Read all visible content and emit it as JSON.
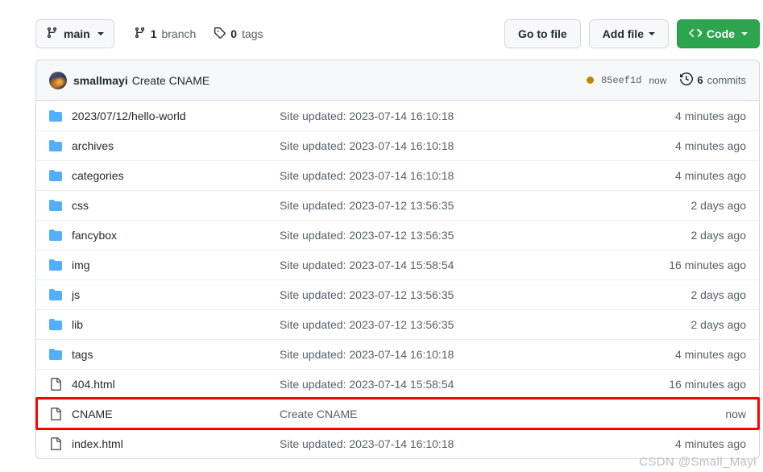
{
  "toolbar": {
    "branch": {
      "label": "main",
      "icon": "branch-icon",
      "caret": "chevron-down-icon"
    },
    "stats": [
      {
        "count": "1",
        "label": "branch",
        "icon": "branch-icon"
      },
      {
        "count": "0",
        "label": "tags",
        "icon": "tag-icon"
      }
    ],
    "go_to_file_label": "Go to file",
    "add_file_label": "Add file",
    "code_label": "Code"
  },
  "commit_bar": {
    "author": "smallmayi",
    "message": "Create CNAME",
    "status_dot_color": "#bf8700",
    "sha": "85eef1d",
    "when": "now",
    "commits_count": "6",
    "commits_label": "commits",
    "history_icon": "history-clock-icon"
  },
  "files": [
    {
      "type": "folder",
      "name": "2023/07/12/hello-world",
      "message": "Site updated: 2023-07-14 16:10:18",
      "time": "4 minutes ago",
      "highlighted": false
    },
    {
      "type": "folder",
      "name": "archives",
      "message": "Site updated: 2023-07-14 16:10:18",
      "time": "4 minutes ago",
      "highlighted": false
    },
    {
      "type": "folder",
      "name": "categories",
      "message": "Site updated: 2023-07-14 16:10:18",
      "time": "4 minutes ago",
      "highlighted": false
    },
    {
      "type": "folder",
      "name": "css",
      "message": "Site updated: 2023-07-12 13:56:35",
      "time": "2 days ago",
      "highlighted": false
    },
    {
      "type": "folder",
      "name": "fancybox",
      "message": "Site updated: 2023-07-12 13:56:35",
      "time": "2 days ago",
      "highlighted": false
    },
    {
      "type": "folder",
      "name": "img",
      "message": "Site updated: 2023-07-14 15:58:54",
      "time": "16 minutes ago",
      "highlighted": false
    },
    {
      "type": "folder",
      "name": "js",
      "message": "Site updated: 2023-07-12 13:56:35",
      "time": "2 days ago",
      "highlighted": false
    },
    {
      "type": "folder",
      "name": "lib",
      "message": "Site updated: 2023-07-12 13:56:35",
      "time": "2 days ago",
      "highlighted": false
    },
    {
      "type": "folder",
      "name": "tags",
      "message": "Site updated: 2023-07-14 16:10:18",
      "time": "4 minutes ago",
      "highlighted": false
    },
    {
      "type": "file",
      "name": "404.html",
      "message": "Site updated: 2023-07-14 15:58:54",
      "time": "16 minutes ago",
      "highlighted": false
    },
    {
      "type": "file",
      "name": "CNAME",
      "message": "Create CNAME",
      "time": "now",
      "highlighted": true
    },
    {
      "type": "file",
      "name": "index.html",
      "message": "Site updated: 2023-07-14 16:10:18",
      "time": "4 minutes ago",
      "highlighted": false
    }
  ],
  "annotation": {
    "target": "CNAME",
    "color": "#ff0000"
  },
  "watermark": "CSDN @Small_Mayi",
  "colors": {
    "accent_green": "#2da44e",
    "folder_blue": "#54aeff",
    "border": "#d0d7de",
    "muted_text": "#57606a",
    "primary_text": "#24292f",
    "header_bg": "#f6f8fa"
  }
}
